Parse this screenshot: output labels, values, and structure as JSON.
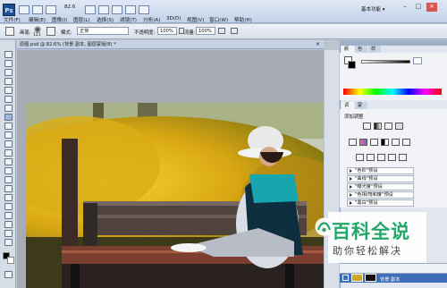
{
  "titlebar": {
    "logo": "Ps",
    "zoom": "82.6",
    "workspace": "基本功能 ▾",
    "window_controls": [
      "–",
      "□",
      "×"
    ]
  },
  "menu": [
    "文件(F)",
    "编辑(E)",
    "图像(I)",
    "图层(L)",
    "选择(S)",
    "滤镜(T)",
    "分析(A)",
    "3D(D)",
    "视图(V)",
    "窗口(W)",
    "帮助(H)"
  ],
  "options": {
    "brush_label": "画笔:",
    "brush_size": "121",
    "mode_label": "模式:",
    "mode_value": "正常",
    "opacity_label": "不透明度:",
    "opacity_value": "100%",
    "flow_label": "流量:",
    "flow_value": "100%"
  },
  "document": {
    "tab_title": "原图.psd @ 82.6% (背景 副本, 图层蒙版/8) *"
  },
  "panels": {
    "color_tabs": [
      "颜色",
      "色板",
      "样式"
    ],
    "adjust_tabs": [
      "调整",
      "蒙版"
    ],
    "adjust_title": "添加调整",
    "presets": [
      "\"色阶\"预设",
      "\"曲线\"预设",
      "\"曝光度\"预设",
      "\"色相/饱和度\"预设",
      "\"黑白\"预设"
    ],
    "layer_name": "背景 副本"
  },
  "watermark": {
    "title": "百科全说",
    "subtitle": "助你轻松解决"
  }
}
